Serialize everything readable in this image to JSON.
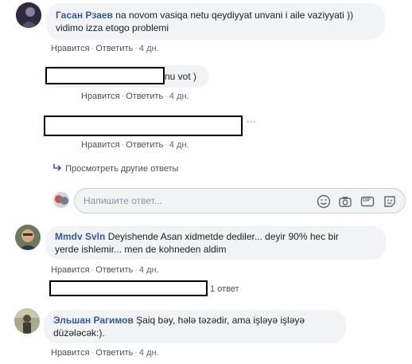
{
  "comment1": {
    "author": "Гасан Рзаев",
    "text_line1": "na novom vasiqa netu qeydiyyat unvani i aile vaziyyati ))",
    "text_line2": "vidimo izza etogo problemi",
    "actions": {
      "like": "Нравится",
      "reply": "Ответить",
      "time": "4 дн."
    }
  },
  "reply1": {
    "text_visible": "nu vot )",
    "actions": {
      "like": "Нравится",
      "reply": "Ответить",
      "time": "4 дн."
    }
  },
  "reply2": {
    "actions": {
      "like": "Нравится",
      "reply": "Ответить",
      "time": "4 дн."
    },
    "more": "•••"
  },
  "view_more": {
    "label": "Просмотреть другие ответы"
  },
  "reply_box": {
    "placeholder": "Напишите ответ...",
    "tools": [
      "emoji-icon",
      "camera-icon",
      "gif-icon",
      "sticker-icon"
    ],
    "gif_label": "GIF"
  },
  "comment2": {
    "author": "Mmdv Svln",
    "text_line1": "Deyishende Asan xidmetde dediler... deyir 90% hec bir",
    "text_line2": "yerde ishlemir... men de kohneden aldim",
    "actions": {
      "like": "Нравится",
      "reply": "Ответить",
      "time": "4 дн."
    },
    "replies_count": "1 ответ"
  },
  "comment3": {
    "author": "Эльшан Рагимов",
    "text_line1": "Şaiq bəy, hələ təzədir, ama işləyə işləyə",
    "text_line2": "düzələcək:).",
    "actions": {
      "like": "Нравится",
      "reply": "Ответить",
      "time": "4 дн."
    }
  },
  "colors": {
    "link": "#385898",
    "bubble": "#f2f3f5",
    "meta": "#616770"
  }
}
